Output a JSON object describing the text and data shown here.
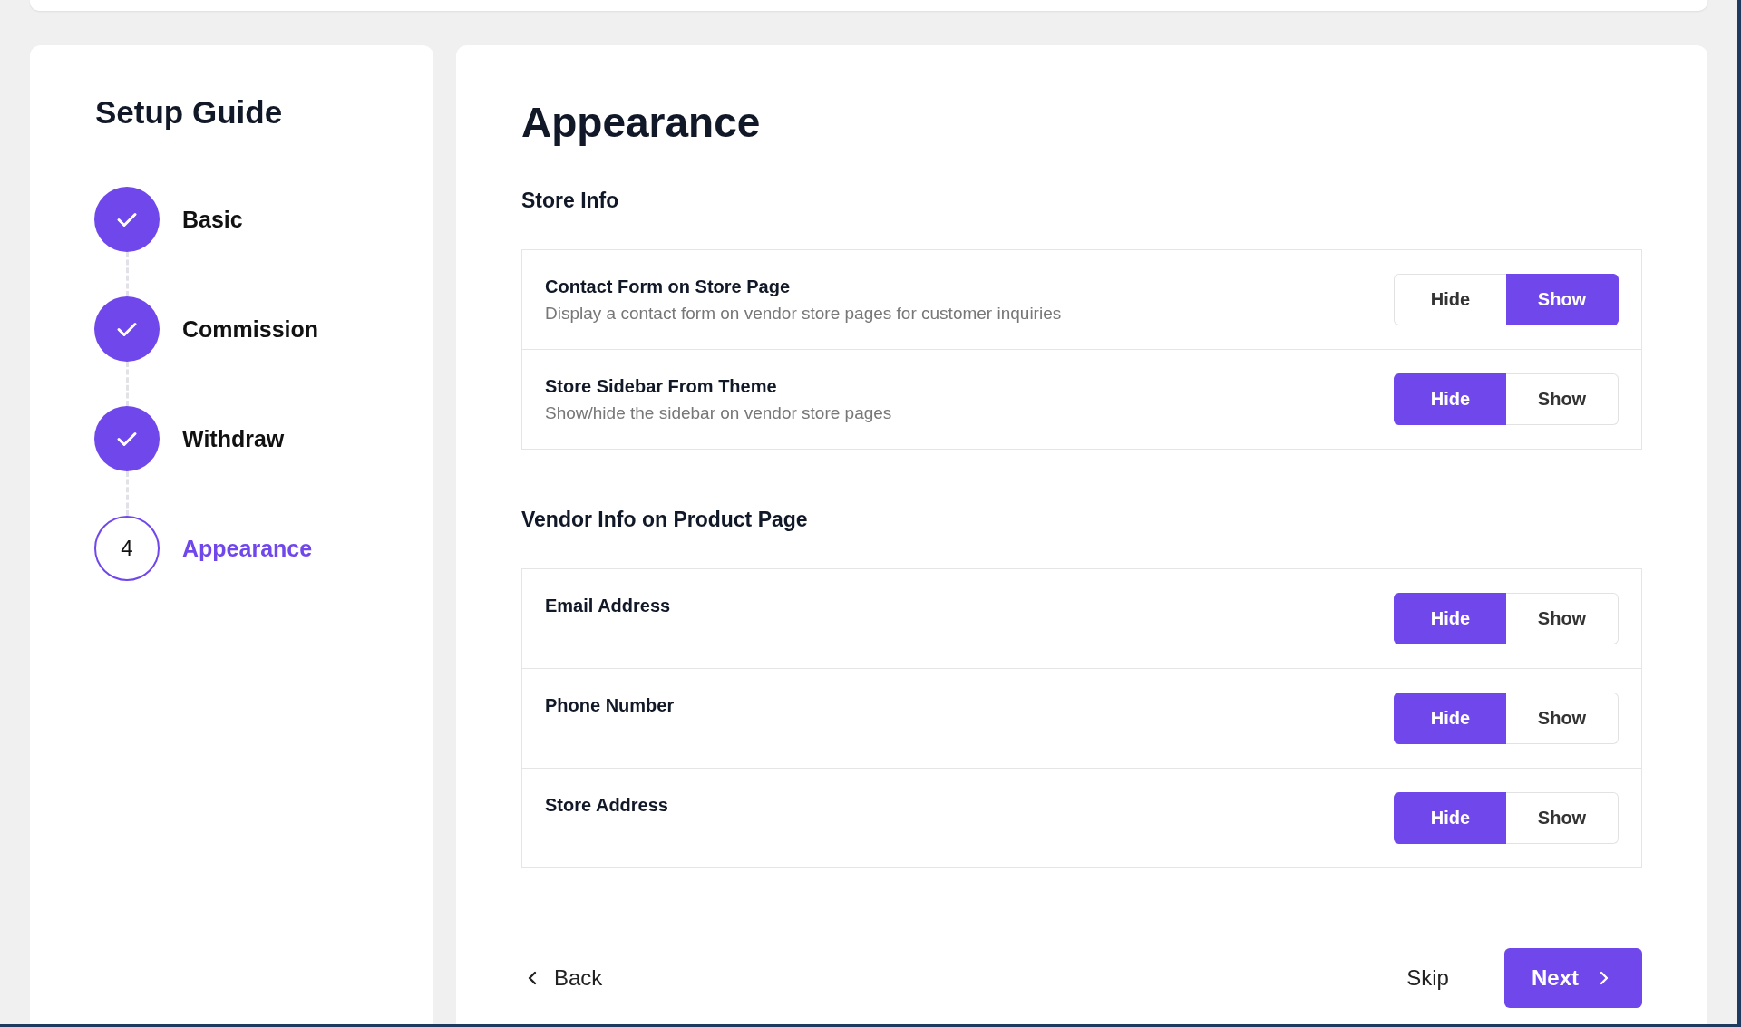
{
  "sidebar": {
    "title": "Setup Guide",
    "steps": [
      {
        "label": "Basic",
        "completed": true,
        "selected": false
      },
      {
        "label": "Commission",
        "completed": true,
        "selected": false
      },
      {
        "label": "Withdraw",
        "completed": true,
        "selected": false
      },
      {
        "label": "Appearance",
        "completed": false,
        "selected": true,
        "number": "4"
      }
    ]
  },
  "main": {
    "title": "Appearance",
    "sections": [
      {
        "heading": "Store Info",
        "rows": [
          {
            "title": "Contact Form on Store Page",
            "description": "Display a contact form on vendor store pages for customer inquiries",
            "options": [
              {
                "label": "Hide",
                "selected": false
              },
              {
                "label": "Show",
                "selected": true
              }
            ]
          },
          {
            "title": "Store Sidebar From Theme",
            "description": "Show/hide the sidebar on vendor store pages",
            "options": [
              {
                "label": "Hide",
                "selected": true
              },
              {
                "label": "Show",
                "selected": false
              }
            ]
          }
        ]
      },
      {
        "heading": "Vendor Info on Product Page",
        "rows": [
          {
            "title": "Email Address",
            "options": [
              {
                "label": "Hide",
                "selected": true
              },
              {
                "label": "Show",
                "selected": false
              }
            ]
          },
          {
            "title": "Phone Number",
            "options": [
              {
                "label": "Hide",
                "selected": true
              },
              {
                "label": "Show",
                "selected": false
              }
            ]
          },
          {
            "title": "Store Address",
            "options": [
              {
                "label": "Hide",
                "selected": true
              },
              {
                "label": "Show",
                "selected": false
              }
            ]
          }
        ]
      }
    ],
    "footer": {
      "back": "Back",
      "skip": "Skip",
      "next": "Next"
    }
  }
}
